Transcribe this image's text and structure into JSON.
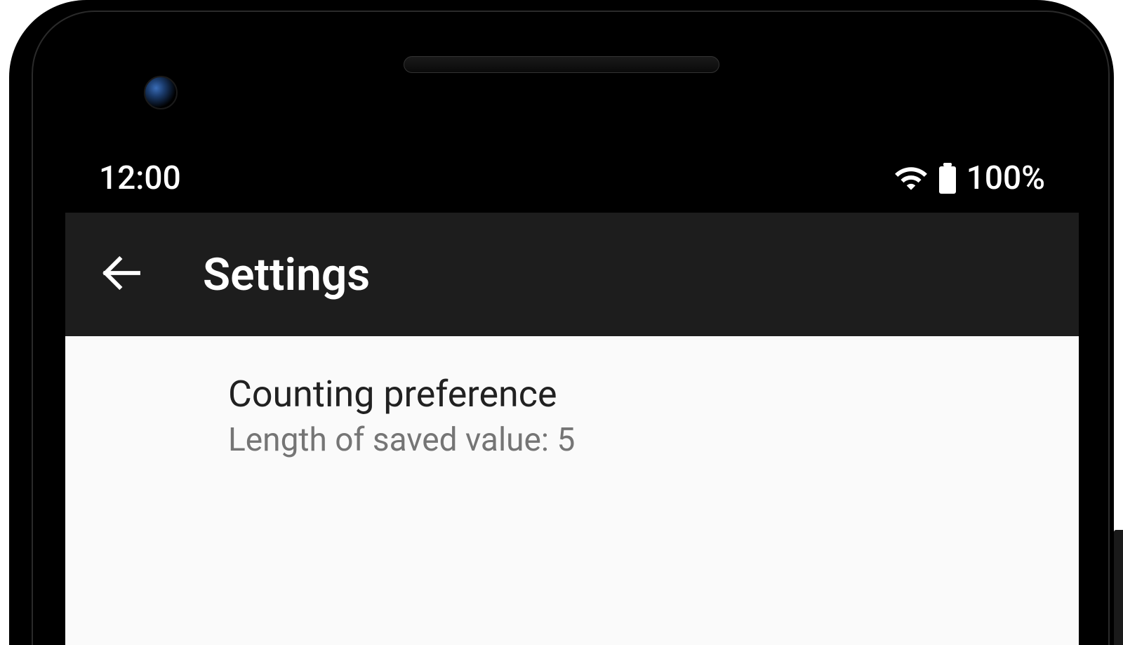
{
  "status_bar": {
    "time": "12:00",
    "battery_percent": "100%"
  },
  "app_bar": {
    "title": "Settings"
  },
  "preferences": {
    "counting": {
      "title": "Counting preference",
      "summary": "Length of saved value: 5"
    }
  }
}
